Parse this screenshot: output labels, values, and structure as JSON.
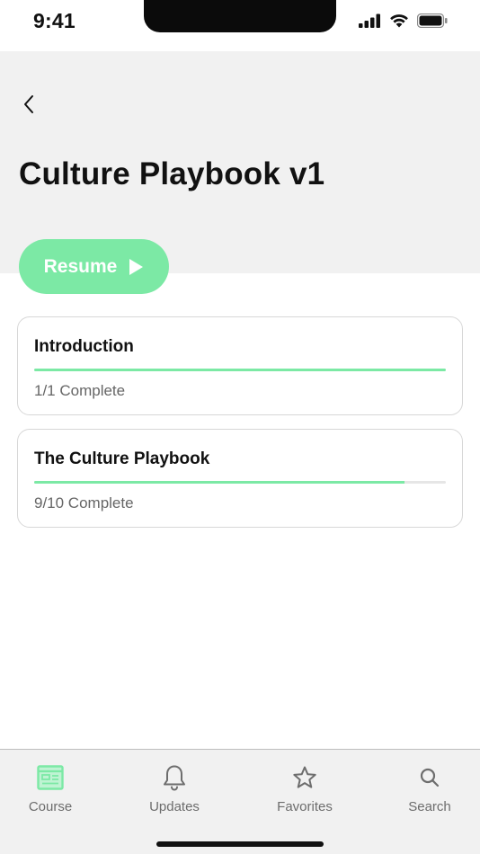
{
  "status_bar": {
    "time": "9:41"
  },
  "header": {
    "title": "Culture Playbook v1"
  },
  "resume_button": {
    "label": "Resume"
  },
  "sections": [
    {
      "title": "Introduction",
      "status": "1/1 Complete",
      "progress": 1.0
    },
    {
      "title": "The Culture Playbook",
      "status": "9/10 Complete",
      "progress": 0.9
    }
  ],
  "tab_bar": {
    "tabs": [
      {
        "label": "Course",
        "icon": "course-icon",
        "active": true
      },
      {
        "label": "Updates",
        "icon": "bell-icon",
        "active": false
      },
      {
        "label": "Favorites",
        "icon": "star-icon",
        "active": false
      },
      {
        "label": "Search",
        "icon": "search-icon",
        "active": false
      }
    ]
  },
  "colors": {
    "accent": "#7ce9a5",
    "header_background": "#f1f1f1",
    "text_primary": "#111111",
    "text_secondary": "#666666",
    "tab_inactive": "#6d6d6d"
  }
}
